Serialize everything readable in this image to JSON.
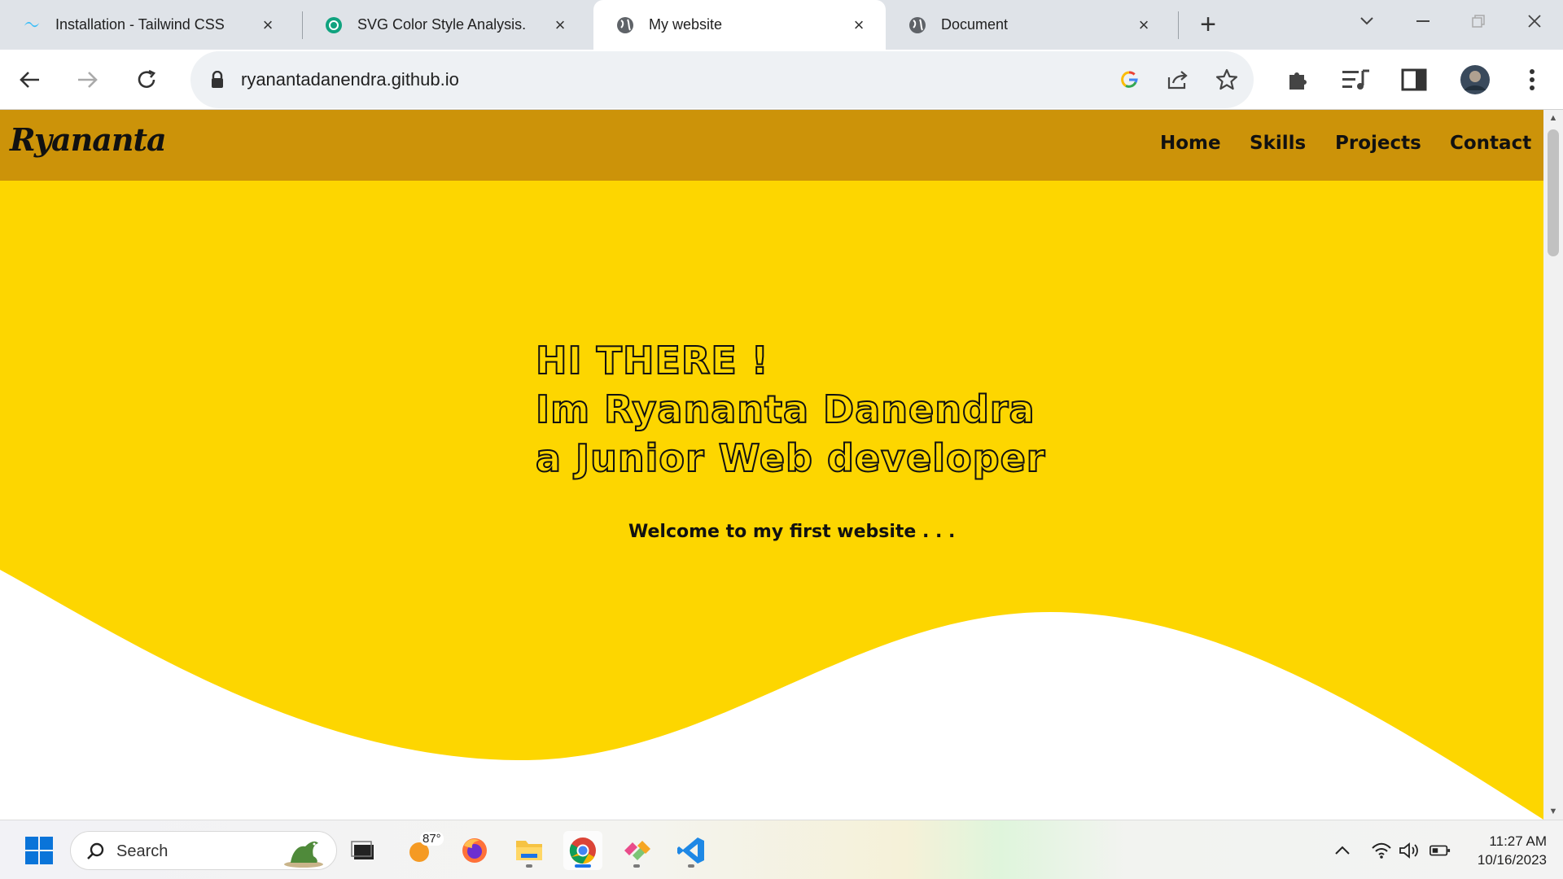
{
  "browser": {
    "tabs": [
      {
        "title": "Installation - Tailwind CSS",
        "icon": "tailwind-icon"
      },
      {
        "title": "SVG Color Style Analysis.",
        "icon": "chatgpt-icon"
      },
      {
        "title": "My website",
        "icon": "globe-icon",
        "active": true
      },
      {
        "title": "Document",
        "icon": "globe-icon"
      }
    ],
    "url": "ryanantadanendra.github.io"
  },
  "site": {
    "logo": "Ryananta",
    "nav": [
      "Home",
      "Skills",
      "Projects",
      "Contact"
    ],
    "hero": {
      "line1": "HI THERE !",
      "line2": "Im Ryananta Danendra",
      "line3": "a Junior Web developer",
      "subtitle": "Welcome to my first website . . ."
    },
    "colors": {
      "nav_bg": "#cc9309",
      "hero_bg": "#fdd600",
      "text": "#111111"
    }
  },
  "taskbar": {
    "search_label": "Search",
    "weather_temp": "87°",
    "time": "11:27 AM",
    "date": "10/16/2023"
  }
}
